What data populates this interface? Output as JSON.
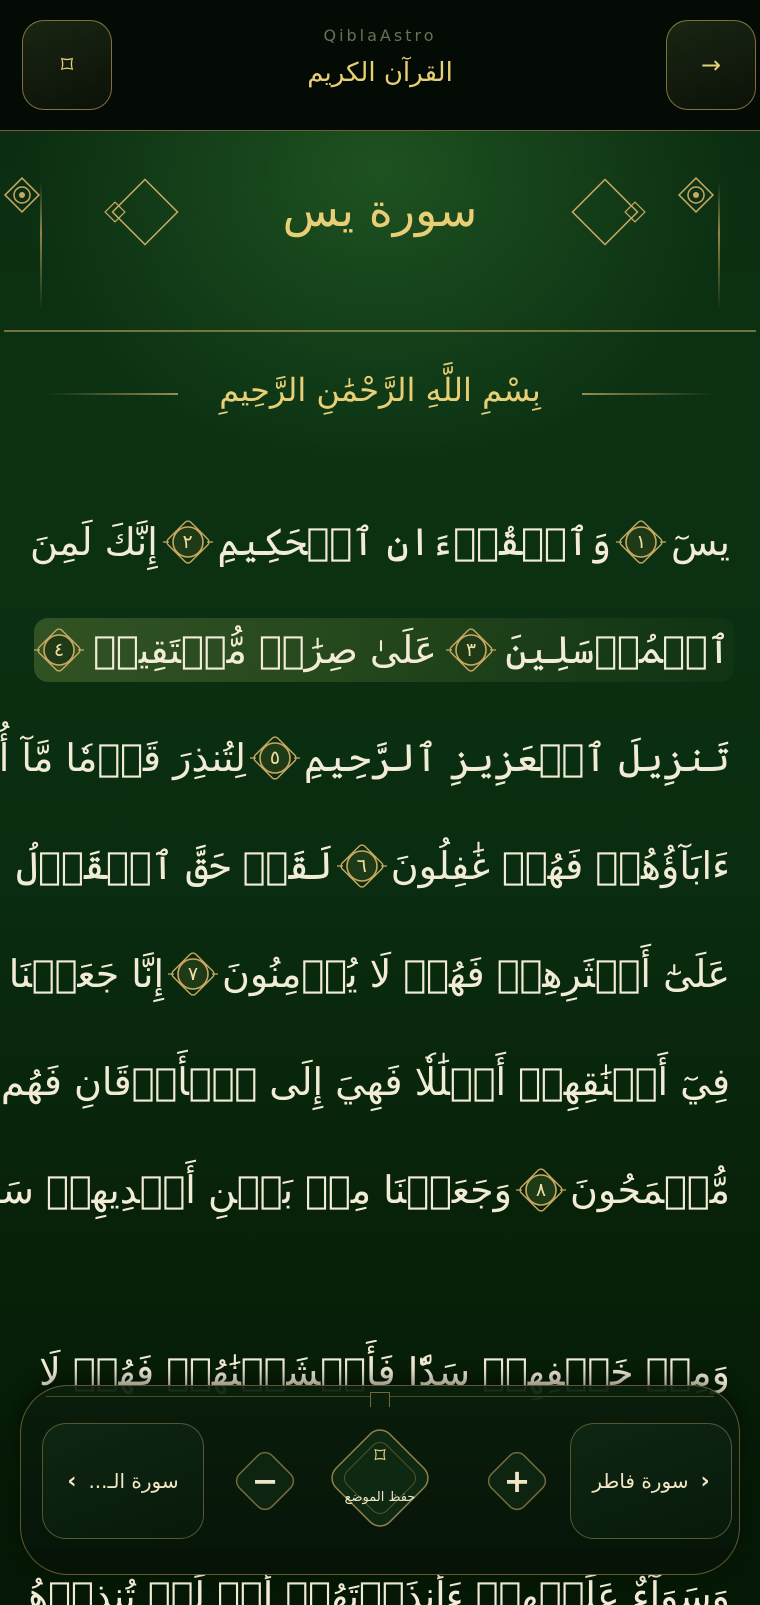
{
  "app": {
    "name": "QiblaAstro",
    "title": "القرآن الكريم",
    "menu_icon": "star-octagram-icon",
    "back_icon": "arrow-right-icon",
    "back_glyph": "→",
    "menu_glyph": "⌑"
  },
  "surah": {
    "title": "سورة يس",
    "basmala": "بِسْمِ اللَّهِ الرَّحْمَٰنِ الرَّحِيمِ"
  },
  "verses": {
    "lines": [
      {
        "segments": [
          "يسٓ",
          "١",
          "وَٱلۡقُرۡءَانِ ٱلۡحَكِيمِ",
          "٢",
          "إِنَّكَ لَمِنَ"
        ]
      },
      {
        "segments": [
          "ٱلۡمُرۡسَلِينَ",
          "٣",
          "عَلَىٰ صِرَٰطٖ مُّسۡتَقِيمٖ",
          "٤"
        ]
      },
      {
        "segments": [
          "تَنزِيلَ ٱلۡعَزِيزِ ٱلرَّحِيمِ",
          "٥",
          "لِتُنذِرَ قَوۡمٗا مَّآ أُنذِرَ"
        ]
      },
      {
        "segments": [
          "ءَابَآؤُهُمۡ فَهُمۡ غَٰفِلُونَ",
          "٦",
          "لَقَدۡ حَقَّ ٱلۡقَوۡلُ"
        ]
      },
      {
        "segments": [
          "عَلَىٰٓ أَكۡثَرِهِمۡ فَهُمۡ لَا يُؤۡمِنُونَ",
          "٧",
          "إِنَّا جَعَلۡنَا"
        ]
      },
      {
        "segments": [
          "فِيٓ أَعۡنَٰقِهِمۡ أَغۡلَٰلٗا فَهِيَ إِلَى ٱلۡأَذۡقَانِ فَهُم"
        ]
      },
      {
        "segments": [
          "مُّقۡمَحُونَ",
          "٨",
          "وَجَعَلۡنَا مِنۢ بَيۡنِ أَيۡدِيهِمۡ سَدّٗا"
        ]
      }
    ],
    "partial_line": "وَمِنۡ خَلۡفِهِمۡ سَدّٗا فَأَغۡشَيۡنَٰهُمۡ فَهُمۡ لَا يُبۡصِرُونَ",
    "partial_bottom": "وَسَوَآءٌ عَلَيۡهِمۡ ءَأَنذَرۡتَهُمۡ أَمۡ لَمۡ تُنذِرۡهُمۡ"
  },
  "bottom_nav": {
    "prev_surah": "سورة فاطر",
    "next_surah": "سورة الـ...",
    "bookmark_label": "حفظ الموضع",
    "bookmark_icon": "star-octagram-icon",
    "bookmark_glyph": "⌑",
    "plus_icon": "plus-icon",
    "minus_icon": "minus-icon",
    "plus_glyph": "+",
    "minus_glyph": "−",
    "prev_chevron": "‹",
    "next_chevron": "›"
  },
  "colors": {
    "gold": "#e8cf75",
    "gold_border": "#c9a961",
    "background_dark": "#071407",
    "background_green": "#0c3213",
    "verse_text": "#f2ecd6"
  }
}
